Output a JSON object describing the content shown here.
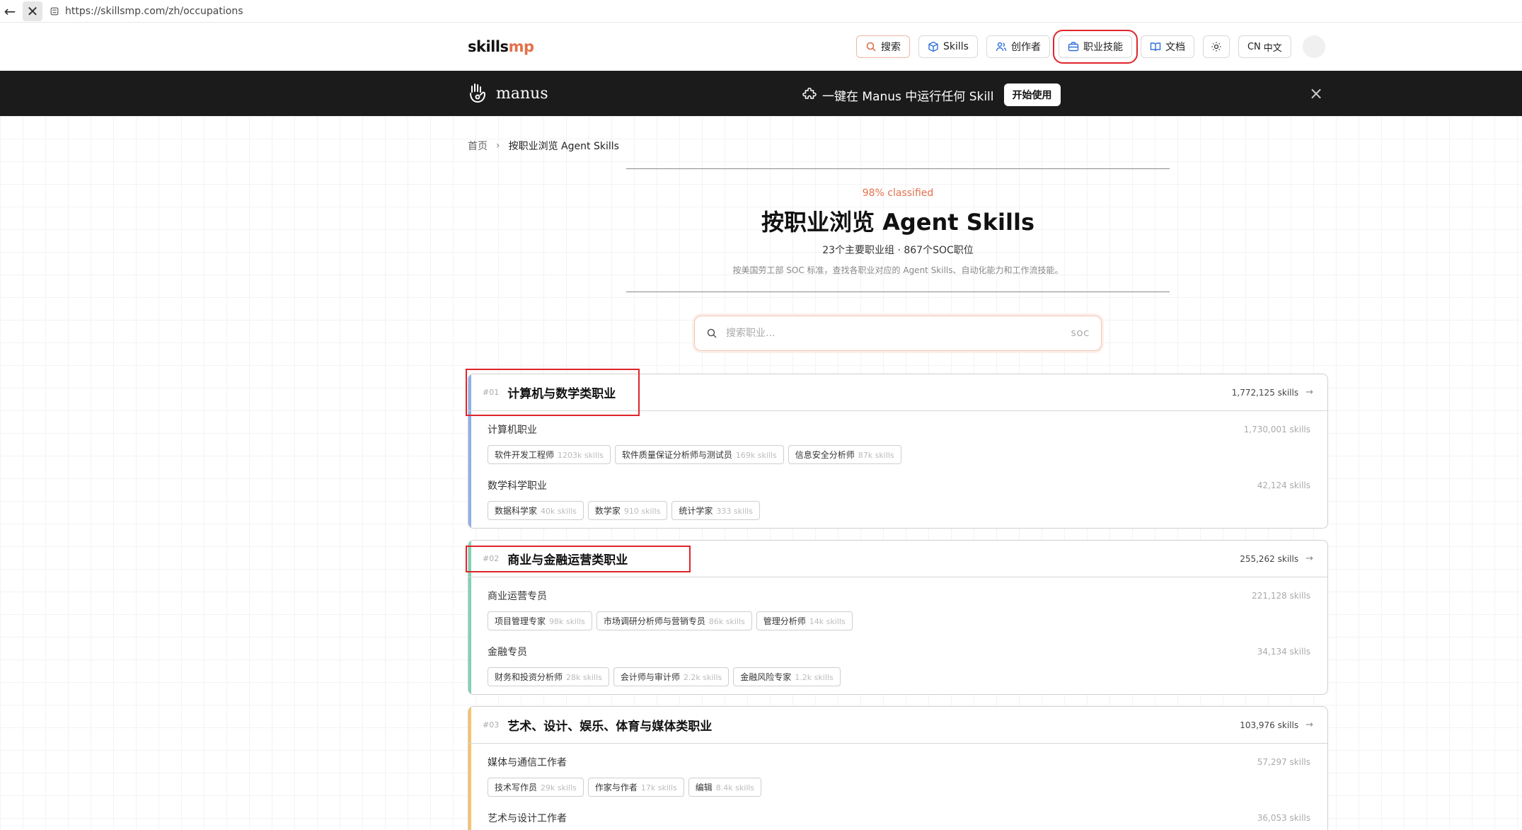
{
  "browser": {
    "url": "https://skillsmp.com/zh/occupations"
  },
  "header": {
    "logo_main": "skills",
    "logo_accent": "mp",
    "nav": {
      "search": "搜索",
      "skills": "Skills",
      "creator": "创作者",
      "occupation": "职业技能",
      "docs": "文档",
      "lang_code": "CN",
      "lang_label": "中文"
    }
  },
  "banner": {
    "brand": "manus",
    "text": "一键在 Manus 中运行任何 Skill",
    "button": "开始使用",
    "close": "×"
  },
  "breadcrumb": {
    "home": "首页",
    "separator": "›",
    "current": "按职业浏览 Agent Skills"
  },
  "hero": {
    "classified": "98% classified",
    "title": "按职业浏览 Agent Skills",
    "subtitle": "23个主要职业组 · 867个SOC职位",
    "description": "按美国劳工部 SOC 标准，查找各职业对应的 Agent Skills、自动化能力和工作流技能。"
  },
  "search": {
    "placeholder": "搜索职业...",
    "hint": "SOC"
  },
  "categories": [
    {
      "num": "#01",
      "title": "计算机与数学类职业",
      "count": "1,772,125 skills",
      "color": "#8fb0e8",
      "groups": [
        {
          "name": "计算机职业",
          "count": "1,730,001 skills",
          "tags": [
            {
              "label": "软件开发工程师",
              "count": "1203k skills"
            },
            {
              "label": "软件质量保证分析师与测试员",
              "count": "169k skills"
            },
            {
              "label": "信息安全分析师",
              "count": "87k skills"
            }
          ]
        },
        {
          "name": "数学科学职业",
          "count": "42,124 skills",
          "tags": [
            {
              "label": "数据科学家",
              "count": "40k skills"
            },
            {
              "label": "数学家",
              "count": "910 skills"
            },
            {
              "label": "统计学家",
              "count": "333 skills"
            }
          ]
        }
      ]
    },
    {
      "num": "#02",
      "title": "商业与金融运营类职业",
      "count": "255,262 skills",
      "color": "#7fd3b3",
      "groups": [
        {
          "name": "商业运营专员",
          "count": "221,128 skills",
          "tags": [
            {
              "label": "项目管理专家",
              "count": "98k skills"
            },
            {
              "label": "市场调研分析师与营销专员",
              "count": "86k skills"
            },
            {
              "label": "管理分析师",
              "count": "14k skills"
            }
          ]
        },
        {
          "name": "金融专员",
          "count": "34,134 skills",
          "tags": [
            {
              "label": "财务和投资分析师",
              "count": "28k skills"
            },
            {
              "label": "会计师与审计师",
              "count": "2.2k skills"
            },
            {
              "label": "金融风险专家",
              "count": "1.2k skills"
            }
          ]
        }
      ]
    },
    {
      "num": "#03",
      "title": "艺术、设计、娱乐、体育与媒体类职业",
      "count": "103,976 skills",
      "color": "#f5c46b",
      "groups": [
        {
          "name": "媒体与通信工作者",
          "count": "57,297 skills",
          "tags": [
            {
              "label": "技术写作员",
              "count": "29k skills"
            },
            {
              "label": "作家与作者",
              "count": "17k skills"
            },
            {
              "label": "编辑",
              "count": "8.4k skills"
            }
          ]
        },
        {
          "name": "艺术与设计工作者",
          "count": "36,053 skills",
          "tags": []
        }
      ]
    }
  ]
}
